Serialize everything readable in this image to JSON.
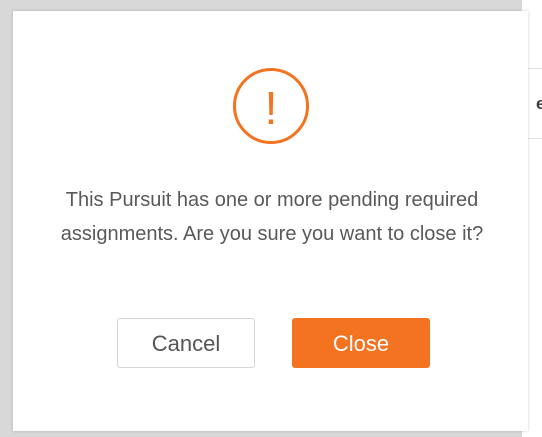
{
  "background": {
    "partial_letter": "e"
  },
  "dialog": {
    "icon": "exclamation-circle-icon",
    "icon_glyph": "!",
    "accent_color": "#f37321",
    "message": "This Pursuit has one or more pending required assignments. Are you sure you want to close it?",
    "cancel_label": "Cancel",
    "close_label": "Close"
  }
}
